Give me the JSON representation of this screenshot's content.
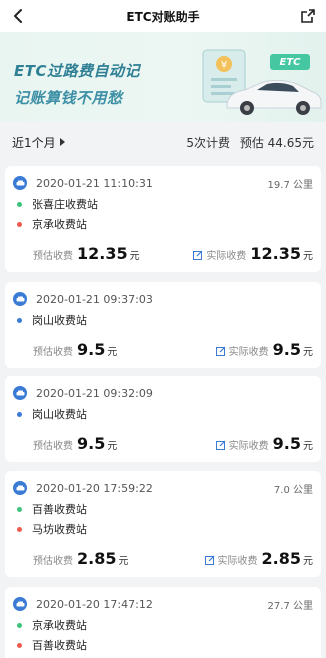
{
  "nav": {
    "title": "ETC对账助手"
  },
  "banner": {
    "line1": "ETC过路费自动记",
    "line2": "记账算钱不用愁",
    "tag": "ETC"
  },
  "summary": {
    "period": "近1个月",
    "count": "5次计费",
    "estimate": "预估 44.65元"
  },
  "labels": {
    "estimated_fee": "预估收费",
    "actual_fee": "实际收费",
    "unit": "元"
  },
  "records": [
    {
      "datetime": "2020-01-21 11:10:31",
      "distance": "19.7 公里",
      "stations": [
        {
          "name": "张喜庄收费站",
          "dot": "green"
        },
        {
          "name": "京承收费站",
          "dot": "red"
        }
      ],
      "estimated": "12.35",
      "actual": "12.35"
    },
    {
      "datetime": "2020-01-21 09:37:03",
      "distance": "",
      "stations": [
        {
          "name": "岗山收费站",
          "dot": "blue"
        }
      ],
      "estimated": "9.5",
      "actual": "9.5"
    },
    {
      "datetime": "2020-01-21 09:32:09",
      "distance": "",
      "stations": [
        {
          "name": "岗山收费站",
          "dot": "blue"
        }
      ],
      "estimated": "9.5",
      "actual": "9.5"
    },
    {
      "datetime": "2020-01-20 17:59:22",
      "distance": "7.0 公里",
      "stations": [
        {
          "name": "百善收费站",
          "dot": "green"
        },
        {
          "name": "马坊收费站",
          "dot": "red"
        }
      ],
      "estimated": "2.85",
      "actual": "2.85"
    },
    {
      "datetime": "2020-01-20 17:47:12",
      "distance": "27.7 公里",
      "stations": [
        {
          "name": "京承收费站",
          "dot": "green"
        },
        {
          "name": "百善收费站",
          "dot": "red"
        }
      ]
    }
  ],
  "colors": {
    "accent": "#3a7bd5",
    "banner_text": "#2f7f95",
    "etc_tag": "#45c7a1",
    "dot_green": "#3cc47c",
    "dot_red": "#ee5b4f"
  }
}
